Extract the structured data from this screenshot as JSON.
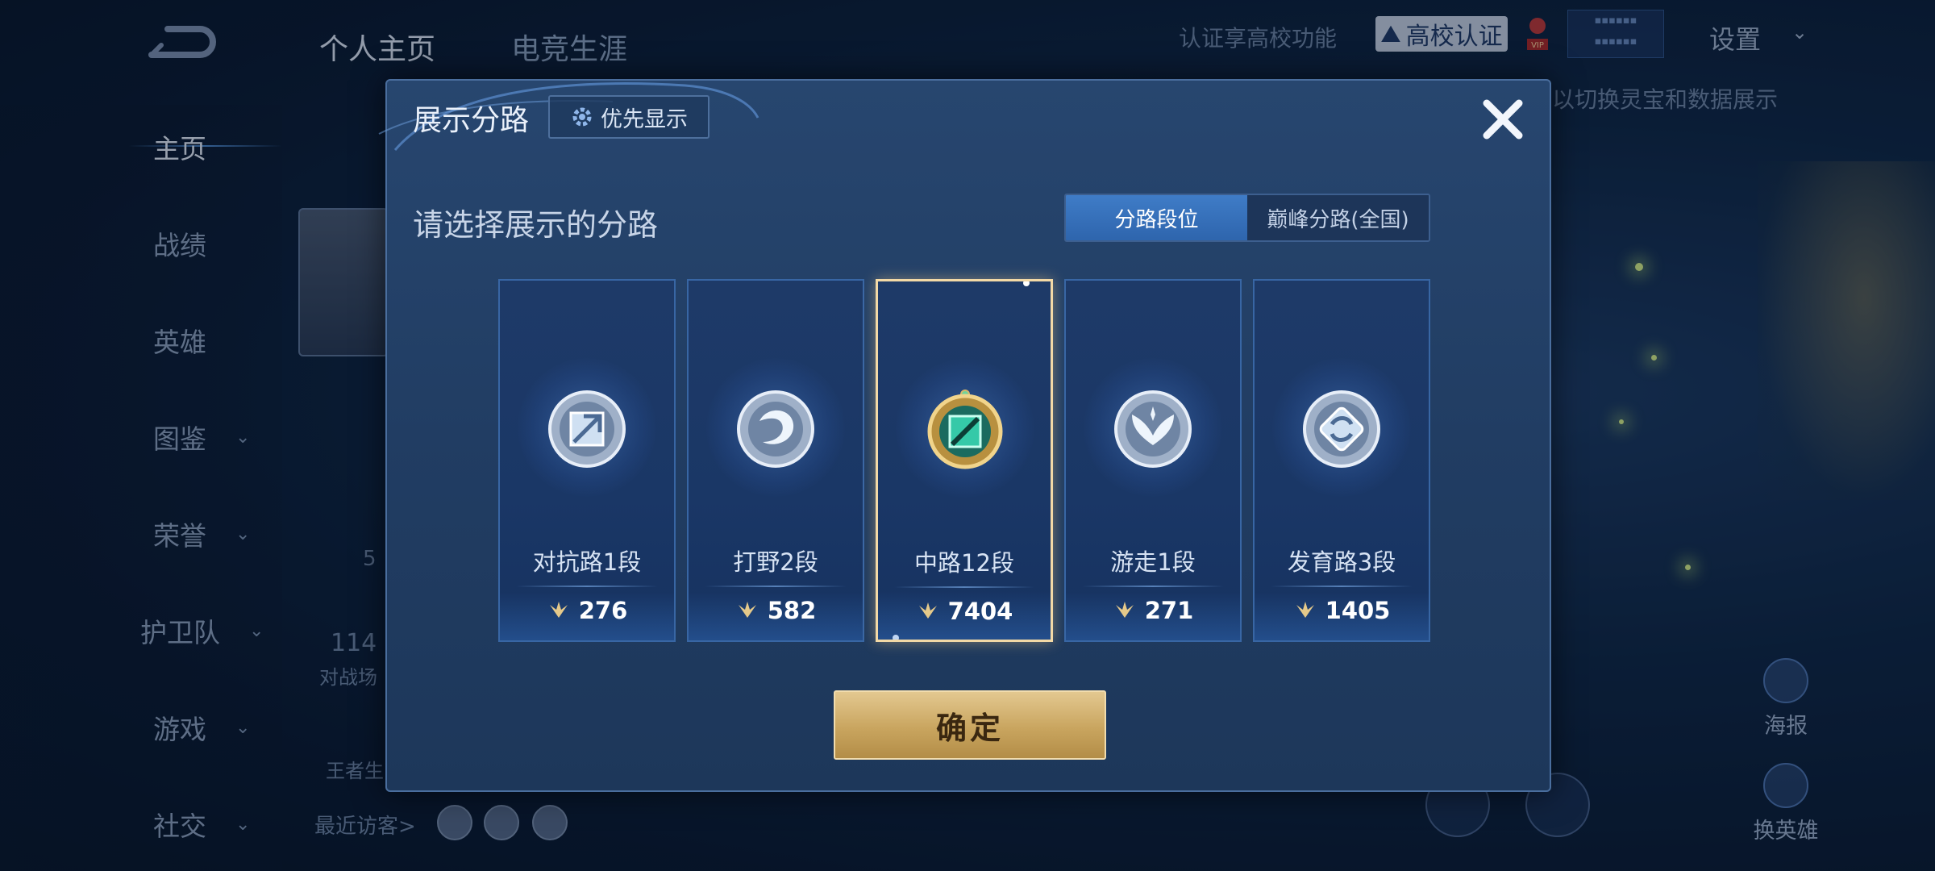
{
  "background": {
    "top_tabs": [
      "个人主页",
      "电竞生涯"
    ],
    "sidebar_items": [
      {
        "label": "主页",
        "has_chevron": false,
        "active": true
      },
      {
        "label": "战绩",
        "has_chevron": false
      },
      {
        "label": "英雄",
        "has_chevron": false
      },
      {
        "label": "图鉴",
        "has_chevron": true
      },
      {
        "label": "荣誉",
        "has_chevron": true
      },
      {
        "label": "护卫队",
        "has_chevron": true
      },
      {
        "label": "游戏",
        "has_chevron": true
      },
      {
        "label": "社交",
        "has_chevron": true
      }
    ],
    "auth_text": "认证享高校功能",
    "auth_badge": "高校认证",
    "vip_label": "VIP",
    "settings_label": "设置",
    "hint_text": "以切换灵宝和数据展示",
    "partial_number": "114",
    "partial_5": "5",
    "partial_label": "对战场",
    "partial_label2": "王者生",
    "visitors_label": "最近访客>",
    "right_buttons": [
      "海报",
      "换英雄"
    ]
  },
  "modal": {
    "title": "展示分路",
    "priority_label": "优先显示",
    "prompt": "请选择展示的分路",
    "toggle_options": [
      "分路段位",
      "巅峰分路(全国)"
    ],
    "toggle_active": 0,
    "lanes": [
      {
        "name": "对抗路1段",
        "score": "276",
        "icon": "sword-shield-icon",
        "selected": false
      },
      {
        "name": "打野2段",
        "score": "582",
        "icon": "dragon-claw-icon",
        "selected": false
      },
      {
        "name": "中路12段",
        "score": "7404",
        "icon": "mid-lane-icon",
        "selected": true
      },
      {
        "name": "游走1段",
        "score": "271",
        "icon": "wings-icon",
        "selected": false
      },
      {
        "name": "发育路3段",
        "score": "1405",
        "icon": "bow-target-icon",
        "selected": false
      }
    ],
    "confirm_label": "确定"
  },
  "colors": {
    "accent_blue": "#3f7cc7",
    "selected_border": "#f3d9a6",
    "confirm_gold": "#c9a55f"
  }
}
